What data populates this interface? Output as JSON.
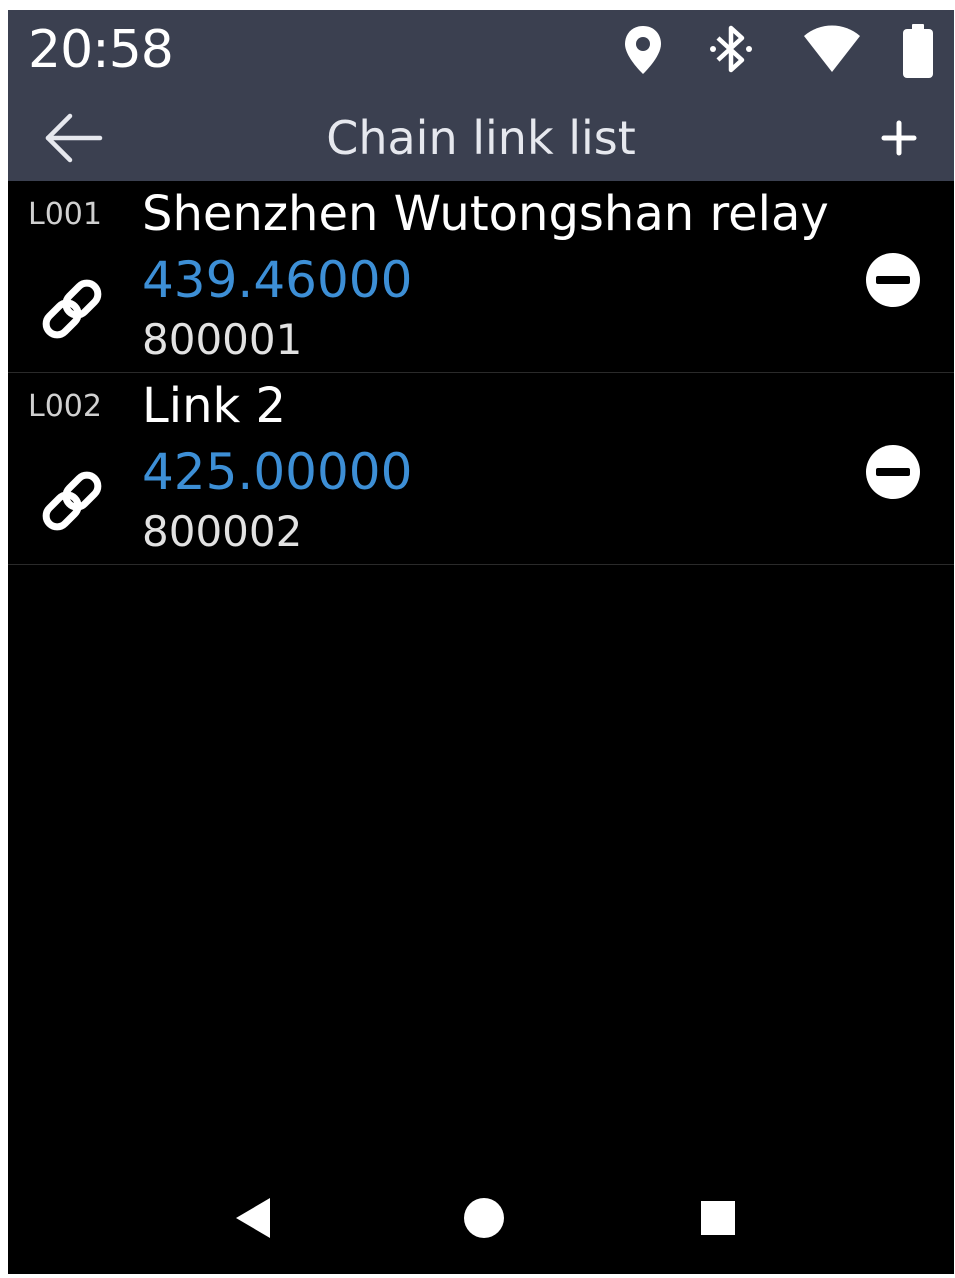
{
  "status_bar": {
    "time": "20:58",
    "icons": [
      "location-icon",
      "bluetooth-icon",
      "wifi-icon",
      "battery-icon"
    ]
  },
  "header": {
    "title": "Chain link list",
    "back_icon": "arrow-left-icon",
    "add_icon": "plus-icon"
  },
  "links": [
    {
      "id": "L001",
      "name": "Shenzhen Wutongshan relay",
      "frequency": "439.46000",
      "code": "800001"
    },
    {
      "id": "L002",
      "name": "Link 2",
      "frequency": "425.00000",
      "code": "800002"
    }
  ],
  "nav_bar": {
    "icons": [
      "nav-back-icon",
      "nav-home-icon",
      "nav-recents-icon"
    ]
  },
  "colors": {
    "header_bg": "#3b4050",
    "background": "#000000",
    "frequency": "#3d8fd6"
  }
}
